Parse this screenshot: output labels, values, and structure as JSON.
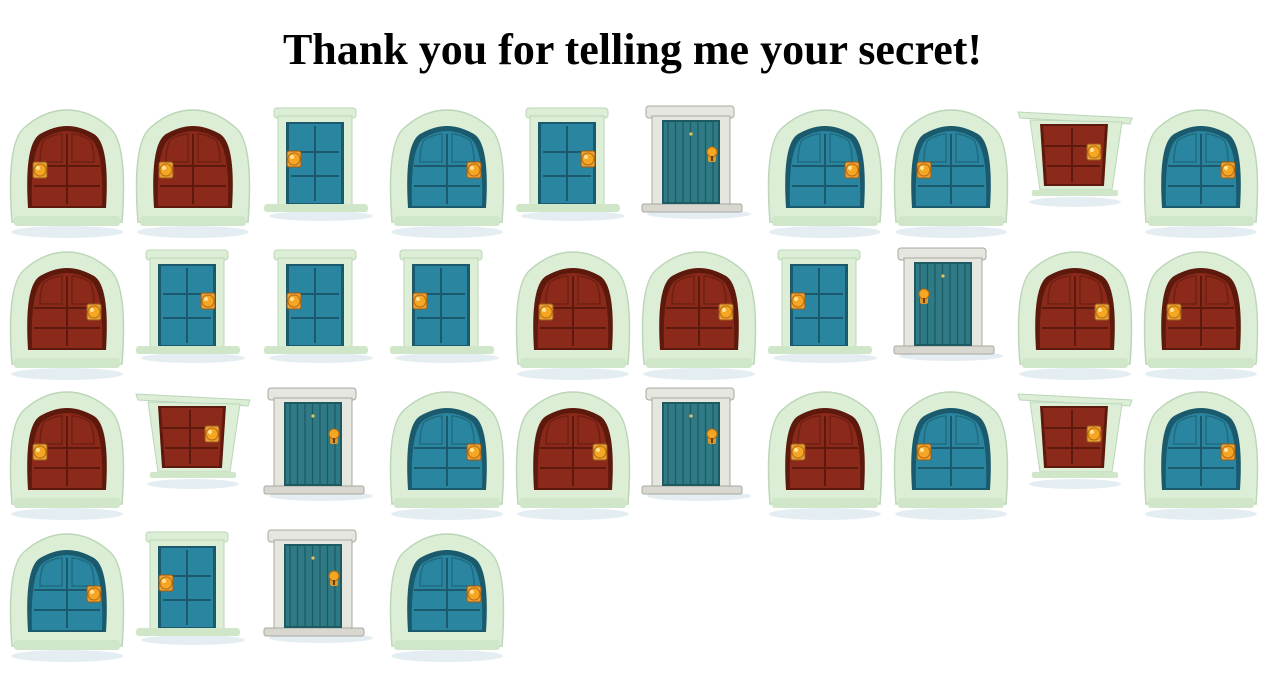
{
  "title": "Thank you for telling me your secret!",
  "colors": {
    "red_door": "#8b2a1a",
    "blue_door": "#2a86a0",
    "teal_plank_door": "#2f7a84",
    "arch_frame": "#dcefd6",
    "stone_frame": "#e6e6e0",
    "knob": "#f5a623"
  },
  "doors": [
    [
      {
        "style": "red-arch",
        "knob": "left"
      },
      {
        "style": "red-arch",
        "knob": "left"
      },
      {
        "style": "blue-rect",
        "knob": "left"
      },
      {
        "style": "blue-arch",
        "knob": "right"
      },
      {
        "style": "blue-rect",
        "knob": "right"
      },
      {
        "style": "teal-plank",
        "knob": "right"
      },
      {
        "style": "blue-arch",
        "knob": "right"
      },
      {
        "style": "blue-arch",
        "knob": "left"
      },
      {
        "style": "red-trap",
        "knob": "right"
      },
      {
        "style": "blue-arch",
        "knob": "right"
      }
    ],
    [
      {
        "style": "red-arch",
        "knob": "right"
      },
      {
        "style": "blue-rect",
        "knob": "right"
      },
      {
        "style": "blue-rect",
        "knob": "left"
      },
      {
        "style": "blue-rect",
        "knob": "left"
      },
      {
        "style": "red-arch",
        "knob": "left"
      },
      {
        "style": "red-arch",
        "knob": "right"
      },
      {
        "style": "blue-rect",
        "knob": "left"
      },
      {
        "style": "teal-plank",
        "knob": "left"
      },
      {
        "style": "red-arch",
        "knob": "right"
      },
      {
        "style": "red-arch",
        "knob": "left"
      }
    ],
    [
      {
        "style": "red-arch",
        "knob": "left"
      },
      {
        "style": "red-trap",
        "knob": "right"
      },
      {
        "style": "teal-plank",
        "knob": "right"
      },
      {
        "style": "blue-arch",
        "knob": "right"
      },
      {
        "style": "red-arch",
        "knob": "right"
      },
      {
        "style": "teal-plank",
        "knob": "right"
      },
      {
        "style": "red-arch",
        "knob": "left"
      },
      {
        "style": "blue-arch",
        "knob": "left"
      },
      {
        "style": "red-trap",
        "knob": "right"
      },
      {
        "style": "blue-arch",
        "knob": "right"
      }
    ],
    [
      {
        "style": "blue-arch",
        "knob": "right"
      },
      {
        "style": "blue-rect",
        "knob": "left"
      },
      {
        "style": "teal-plank",
        "knob": "right"
      },
      {
        "style": "blue-arch",
        "knob": "right"
      }
    ]
  ]
}
